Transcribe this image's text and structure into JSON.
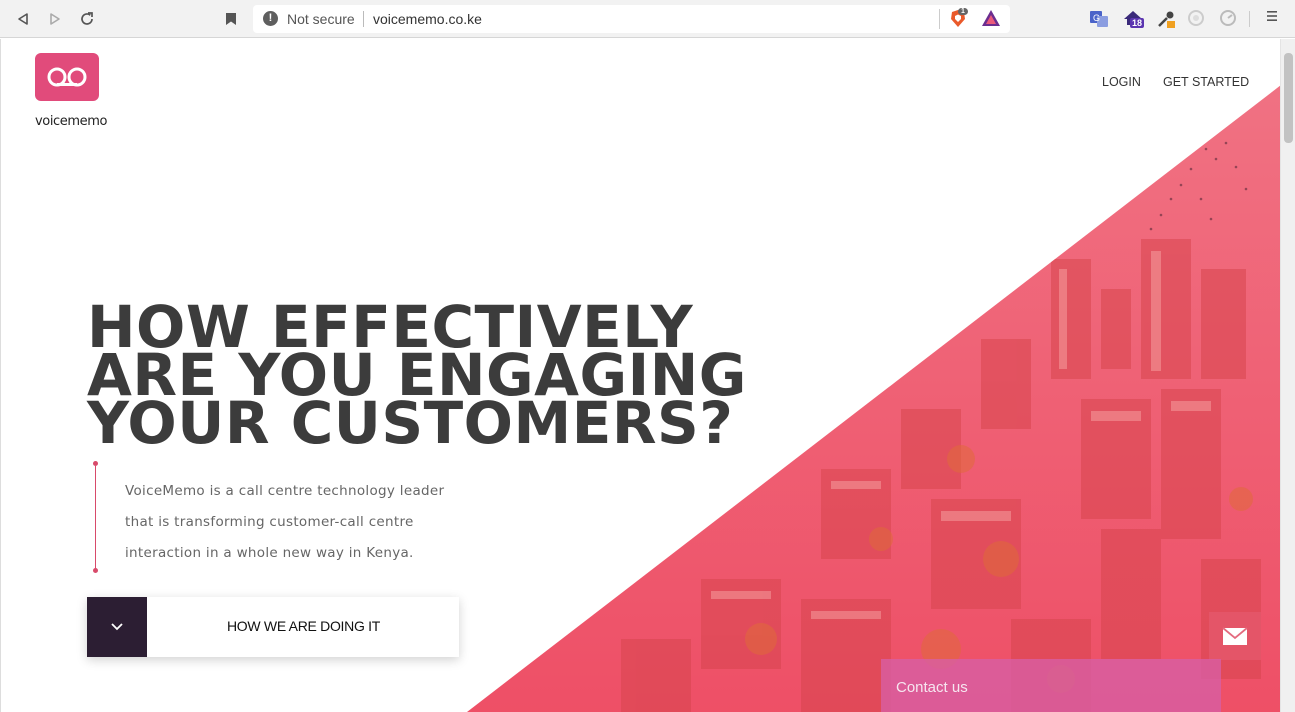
{
  "browser": {
    "security_label": "Not secure",
    "url": "voicememo.co.ke",
    "brave_badge": "1",
    "notifications_badge": "18",
    "icons": [
      "back-icon",
      "forward-icon",
      "reload-icon",
      "bookmark-icon",
      "info-icon",
      "brave-shield-icon",
      "brave-rewards-icon",
      "translate-icon",
      "extension-icon",
      "eyedropper-icon",
      "settings-extension-icon",
      "timer-extension-icon",
      "menu-icon"
    ]
  },
  "site": {
    "logo_text": "voicememo",
    "nav": {
      "login": "LOGIN",
      "get_started": "GET STARTED"
    },
    "headline": [
      "HOW EFFECTIVELY",
      "ARE YOU ENGAGING",
      "YOUR CUSTOMERS?"
    ],
    "lead": [
      "VoiceMemo is a call centre technology leader",
      "that is transforming customer-call centre",
      "interaction in a whole new way in Kenya."
    ],
    "cta_label": "HOW WE ARE DOING IT",
    "contact_label": "Contact us"
  },
  "colors": {
    "brand_pink": "#e14b7b",
    "hero_red": "#f0506a",
    "cta_dark": "#2c1e33",
    "headline": "#3c3c3c"
  }
}
